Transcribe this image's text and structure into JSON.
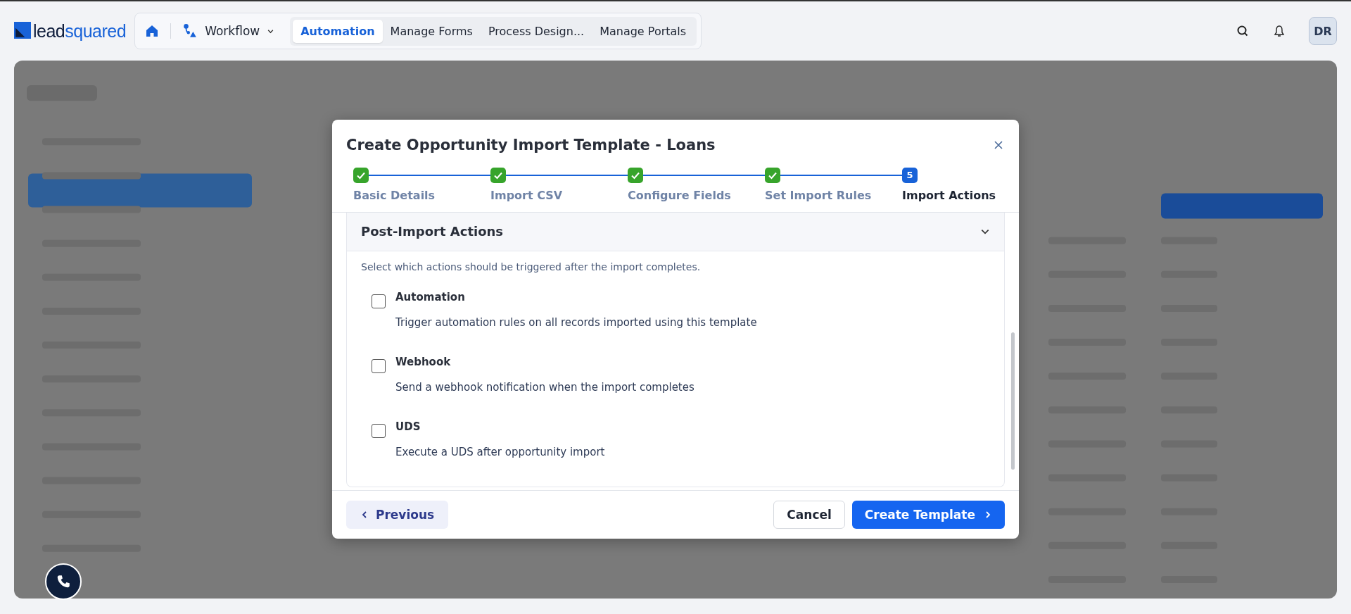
{
  "header": {
    "logo": {
      "prefix": "lead",
      "suffix": "squared"
    },
    "app_switcher": "Workflow",
    "tabs": [
      {
        "label": "Automation",
        "selected": true
      },
      {
        "label": "Manage Forms",
        "selected": false
      },
      {
        "label": "Process Design...",
        "selected": false
      },
      {
        "label": "Manage Portals",
        "selected": false
      }
    ],
    "avatar": "DR"
  },
  "modal": {
    "title": "Create Opportunity Import Template - Loans",
    "steps": [
      {
        "label": "Basic Details",
        "completed": true
      },
      {
        "label": "Import CSV",
        "completed": true
      },
      {
        "label": "Configure Fields",
        "completed": true
      },
      {
        "label": "Set Import Rules",
        "completed": true
      },
      {
        "label": "Import Actions",
        "completed": false,
        "number": "5"
      }
    ],
    "section": {
      "title": "Post-Import Actions",
      "expanded": true,
      "description": "Select which actions should be triggered after the import completes.",
      "options": [
        {
          "title": "Automation",
          "description": "Trigger automation rules on all records imported using this template",
          "checked": false
        },
        {
          "title": "Webhook",
          "description": "Send a webhook notification when the import completes",
          "checked": false
        },
        {
          "title": "UDS",
          "description": "Execute a UDS after opportunity import",
          "checked": false
        }
      ]
    },
    "buttons": {
      "previous": "Previous",
      "cancel": "Cancel",
      "primary": "Create Template"
    }
  }
}
